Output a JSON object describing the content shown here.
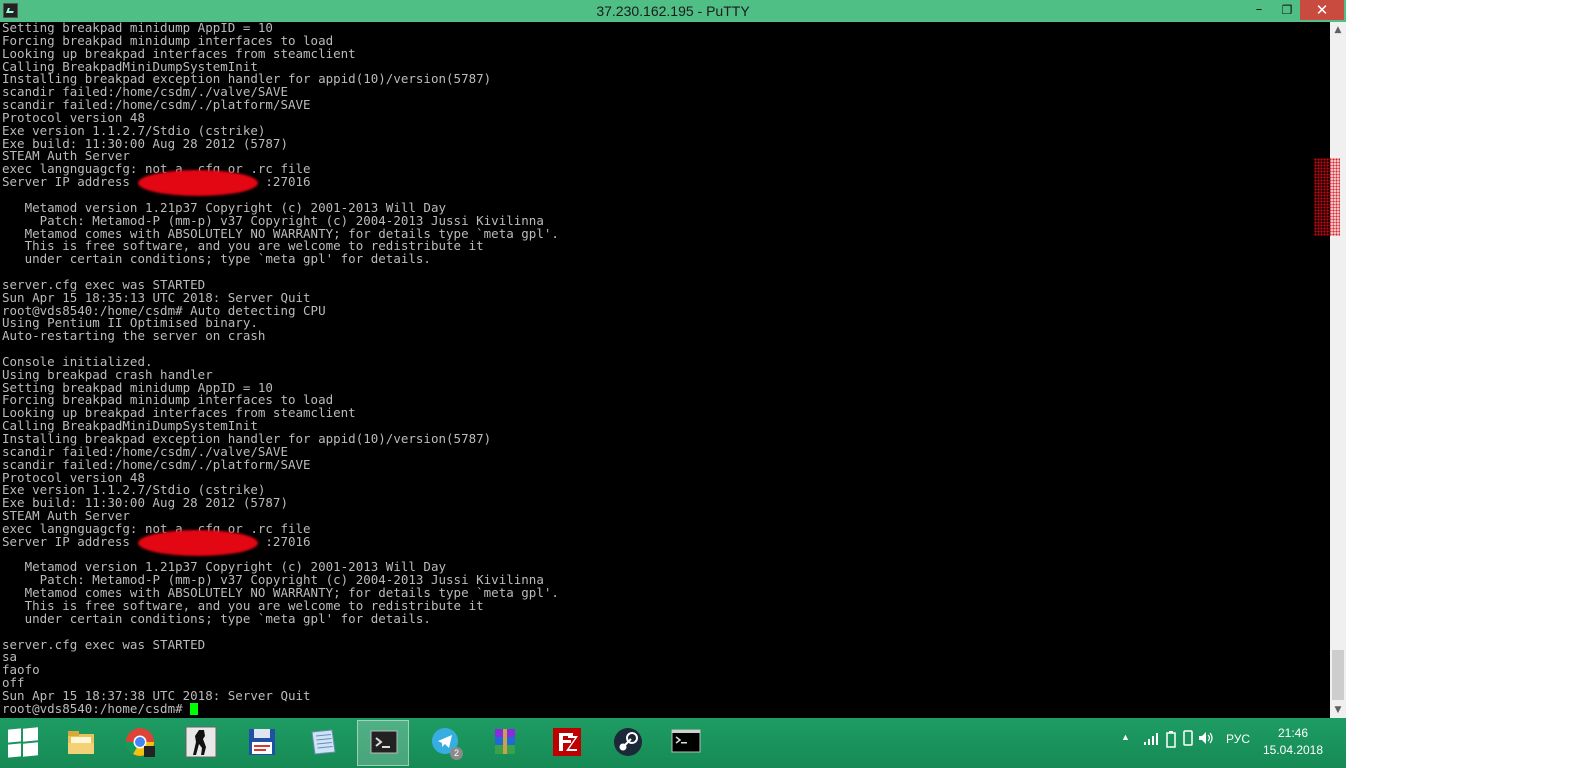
{
  "window": {
    "title": "37.230.162.195 - PuTTY",
    "minimize_glyph": "–",
    "maximize_glyph": "❐",
    "close_glyph": "✕"
  },
  "terminal": {
    "text": "Setting breakpad minidump AppID = 10\nForcing breakpad minidump interfaces to load\nLooking up breakpad interfaces from steamclient\nCalling BreakpadMiniDumpSystemInit\nInstalling breakpad exception handler for appid(10)/version(5787)\nscandir failed:/home/csdm/./valve/SAVE\nscandir failed:/home/csdm/./platform/SAVE\nProtocol version 48\nExe version 1.1.2.7/Stdio (cstrike)\nExe build: 11:30:00 Aug 28 2012 (5787)\nSTEAM Auth Server\nexec langnguagcfg: not a .cfg or .rc file\nServer IP address                  :27016\n\n   Metamod version 1.21p37 Copyright (c) 2001-2013 Will Day\n     Patch: Metamod-P (mm-p) v37 Copyright (c) 2004-2013 Jussi Kivilinna\n   Metamod comes with ABSOLUTELY NO WARRANTY; for details type `meta gpl'.\n   This is free software, and you are welcome to redistribute it\n   under certain conditions; type `meta gpl' for details.\n\nserver.cfg exec was STARTED\nSun Apr 15 18:35:13 UTC 2018: Server Quit\nroot@vds8540:/home/csdm# Auto detecting CPU\nUsing Pentium II Optimised binary.\nAuto-restarting the server on crash\n\nConsole initialized.\nUsing breakpad crash handler\nSetting breakpad minidump AppID = 10\nForcing breakpad minidump interfaces to load\nLooking up breakpad interfaces from steamclient\nCalling BreakpadMiniDumpSystemInit\nInstalling breakpad exception handler for appid(10)/version(5787)\nscandir failed:/home/csdm/./valve/SAVE\nscandir failed:/home/csdm/./platform/SAVE\nProtocol version 48\nExe version 1.1.2.7/Stdio (cstrike)\nExe build: 11:30:00 Aug 28 2012 (5787)\nSTEAM Auth Server\nexec langnguagcfg: not a .cfg or .rc file\nServer IP address                  :27016\n\n   Metamod version 1.21p37 Copyright (c) 2001-2013 Will Day\n     Patch: Metamod-P (mm-p) v37 Copyright (c) 2004-2013 Jussi Kivilinna\n   Metamod comes with ABSOLUTELY NO WARRANTY; for details type `meta gpl'.\n   This is free software, and you are welcome to redistribute it\n   under certain conditions; type `meta gpl' for details.\n\nserver.cfg exec was STARTED\nsa\nfaofo\noff\nSun Apr 15 18:37:38 UTC 2018: Server Quit\n",
    "prompt": "root@vds8540:/home/csdm# ",
    "colors": {
      "background": "#000000",
      "foreground": "#bbbbbb",
      "cursor": "#00ff00"
    }
  },
  "scrollbar": {
    "up_glyph": "▲",
    "down_glyph": "▼"
  },
  "taskbar": {
    "items": [
      {
        "name": "file-explorer",
        "icon": "folder-icon"
      },
      {
        "name": "chrome",
        "icon": "chrome-icon"
      },
      {
        "name": "counter-strike",
        "icon": "counter-strike-icon"
      },
      {
        "name": "save-app",
        "icon": "floppy-disk-icon"
      },
      {
        "name": "notepad",
        "icon": "notepad-icon"
      },
      {
        "name": "putty",
        "icon": "putty-terminal-icon",
        "active": true
      },
      {
        "name": "telegram",
        "icon": "telegram-icon",
        "badge": "2"
      },
      {
        "name": "winrar",
        "icon": "winrar-icon"
      },
      {
        "name": "filezilla",
        "icon": "filezilla-icon"
      },
      {
        "name": "steam",
        "icon": "steam-icon"
      },
      {
        "name": "cmd",
        "icon": "command-prompt-icon"
      }
    ],
    "tray": {
      "language": "РУС",
      "time": "21:46",
      "date": "15.04.2018"
    }
  }
}
